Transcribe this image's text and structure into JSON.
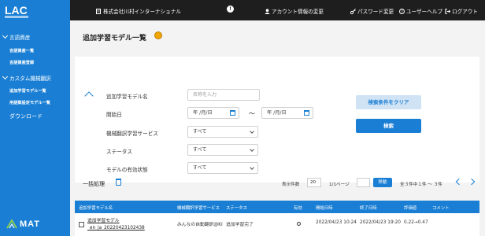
{
  "sidebar": {
    "logo": "LAC",
    "groups": [
      {
        "label": "言語資産",
        "items": [
          "言語資産一覧",
          "言語資産登録"
        ]
      },
      {
        "label": "カスタム機械翻訳",
        "items": [
          "追加学習モデル一覧",
          "用語集設定モデル一覧"
        ]
      }
    ],
    "download": "ダウンロード",
    "footer_brand": "MAT"
  },
  "topbar": {
    "company": "株式会社川村インターナショナル",
    "links": [
      "アカウント情報の変更",
      "パスワード変更",
      "ユーザーヘルプ",
      "ログアウト"
    ]
  },
  "page": {
    "title": "追加学習モデル一覧"
  },
  "filter": {
    "model_name_label": "追加学習モデル名",
    "model_name_placeholder": "名称を入力",
    "start_date_label": "開始日",
    "date_placeholder": "年 /月/日",
    "tilde": "～",
    "service_label": "機械翻訳学習サービス",
    "status_label": "ステータス",
    "validity_label": "モデルの有効状態",
    "select_all": "すべて",
    "clear_button": "検索条件をクリア",
    "search_button": "検索"
  },
  "toolbar": {
    "bulk_label": "一括処理",
    "display_count_label": "表示件数",
    "page_size": "20",
    "page_info": "1/1ページ",
    "move_button": "移動",
    "total_info": "全３件中１件 ～ ３件"
  },
  "table": {
    "columns": [
      "追加学習モデル名",
      "機械翻訳学習サービス",
      "ステータス",
      "有効",
      "開始日時",
      "終了日時",
      "評価値",
      "コメント"
    ],
    "rows": [
      {
        "model_name": "追加学習モデル_en_ja_20220423102438",
        "service": "みんなの自動翻訳@KI",
        "status": "追加学習完了",
        "start": "2022/04/23 10:24",
        "end": "2022/04/23 19:20",
        "score": "0.22→0.47",
        "comment": ""
      }
    ]
  },
  "colors": {
    "sidebar": "#1a7fd4",
    "topbar": "#1e1e1e",
    "accent": "#1a7fd4",
    "badge": "#f0a500"
  }
}
